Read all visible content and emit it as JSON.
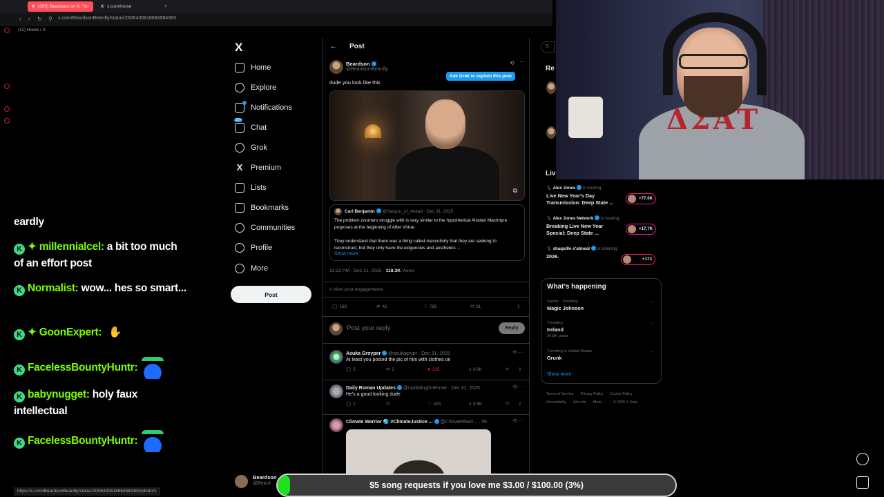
{
  "browser": {
    "tabs": [
      {
        "label": "(395) Beardson on X: \"du",
        "active": true
      },
      {
        "label": "x.com/home",
        "active": false
      }
    ],
    "url": "x.com/BeardsonBeardly/status/2006430818684584383",
    "crumb": "(11) Home / X",
    "status_url": "https://x.com/BeardsonBeardly/status/2006430818684584383/photo/1"
  },
  "chat": {
    "partial_line": "eardly",
    "messages": [
      {
        "user": "millennialcel:",
        "text": "a bit too much of an effort post",
        "diamond": true
      },
      {
        "user": "Normalist:",
        "text": "wow... hes so smart...",
        "diamond": false
      },
      {
        "user": "GoonExpert:",
        "text": "",
        "diamond": true,
        "emote": "hand-emote"
      },
      {
        "user": "FacelessBountyHuntr:",
        "text": "",
        "diamond": false,
        "emote": "blue-emote"
      },
      {
        "user": "babynugget:",
        "text": "holy faux intellectual",
        "diamond": false
      },
      {
        "user": "FacelessBountyHuntr:",
        "text": "",
        "diamond": false,
        "emote": "blue-emote"
      }
    ]
  },
  "nav": {
    "logo": "X",
    "items": [
      {
        "label": "Home",
        "icon": "home-icon"
      },
      {
        "label": "Explore",
        "icon": "search-icon"
      },
      {
        "label": "Notifications",
        "icon": "bell-icon"
      },
      {
        "label": "Chat",
        "icon": "chat-icon"
      },
      {
        "label": "Grok",
        "icon": "grok-icon"
      },
      {
        "label": "Premium",
        "icon": "x-icon"
      },
      {
        "label": "Lists",
        "icon": "list-icon"
      },
      {
        "label": "Bookmarks",
        "icon": "bookmark-icon"
      },
      {
        "label": "Communities",
        "icon": "people-icon"
      },
      {
        "label": "Profile",
        "icon": "person-icon"
      },
      {
        "label": "More",
        "icon": "more-icon"
      }
    ],
    "post_button": "Post",
    "profile_name": "Beardson",
    "profile_handle": "@Beard"
  },
  "post": {
    "header": "Post",
    "author": "Beardson",
    "handle": "@BeardsonBeardly",
    "grok_button": "Ask Grok to explain this post",
    "text": "dude you look like this",
    "quote": {
      "author": "Carl Benjamin",
      "handle_date": "@Sargon_of_Akkad · Dec 31, 2025",
      "text1": "The problem zoomers struggle with is very similar to the hypothetical Alisdair MacIntyre proposes at the beginning of After Virtue.",
      "text2": "They understand that there was a thing called masculinity that they are seeking to reconstruct, but they only have the exigencies and aesthetics ...",
      "show_more": "Show more"
    },
    "time": "12:22 PM · Dec 31, 2025 · ",
    "views_count": "118.3K",
    "views_label": " Views",
    "engagements": "View post engagements",
    "stats": {
      "replies": "168",
      "reposts": "41",
      "likes": "785",
      "bookmarks": "31"
    },
    "reply_placeholder": "Post your reply",
    "reply_button": "Reply"
  },
  "replies": [
    {
      "name": "Asuka Groyper",
      "handle_date": "@asukagrypr · Dec 31, 2025",
      "text": "At least you posted the pic of him with clothes on",
      "stats": {
        "replies": "5",
        "reposts": "2",
        "likes": "215",
        "views": "8.6K"
      }
    },
    {
      "name": "Daily Roman Updates",
      "handle_date": "@UpdatingOnRome · Dec 31, 2025",
      "text": "He's a good looking dude",
      "stats": {
        "replies": "2",
        "reposts": "",
        "likes": "403",
        "views": "8.5K"
      }
    },
    {
      "name": "Climate Warrior 🌏 #ClimateJustice ...",
      "handle_date": "@Cl!mateWarri... · 5h",
      "text": "",
      "stats": {}
    }
  ],
  "right": {
    "search_stub": "S",
    "relevant_stub": "Re",
    "live_stub": "Liv",
    "live": [
      {
        "host": "Alex Jones",
        "status": "is hosting",
        "title": "Live New Year's Day Transmission: Deep State ...",
        "count": "+77.6K"
      },
      {
        "host": "Alex Jones Network",
        "status": "is hosting",
        "title": "Breaking Live New Year Special: Deep State ...",
        "count": "+17.7K"
      },
      {
        "host": "shaquille o'atmeal",
        "status": "is listening",
        "title": "2026.",
        "count": "+173"
      }
    ],
    "happening_title": "What's happening",
    "trends": [
      {
        "context": "Sports · Trending",
        "name": "Magic Johnson",
        "posts": ""
      },
      {
        "context": "Trending",
        "name": "Ireland",
        "posts": "56.8K posts"
      },
      {
        "context": "Trending in United States",
        "name": "Grunk",
        "posts": ""
      }
    ],
    "show_more": "Show more",
    "footer": [
      "Terms of Service",
      "Privacy Policy",
      "Cookie Policy",
      "Accessibility",
      "Ads info",
      "More ···",
      "© 2026 X Corp."
    ]
  },
  "donation": {
    "text": "$5 song requests if you love me $3.00 / $100.00 (3%)",
    "progress": 0.03
  },
  "colors": {
    "accent": "#1d9bf0",
    "like": "#f91880",
    "chat_user": "#7CFC00",
    "donation_fill": "#21e021"
  }
}
